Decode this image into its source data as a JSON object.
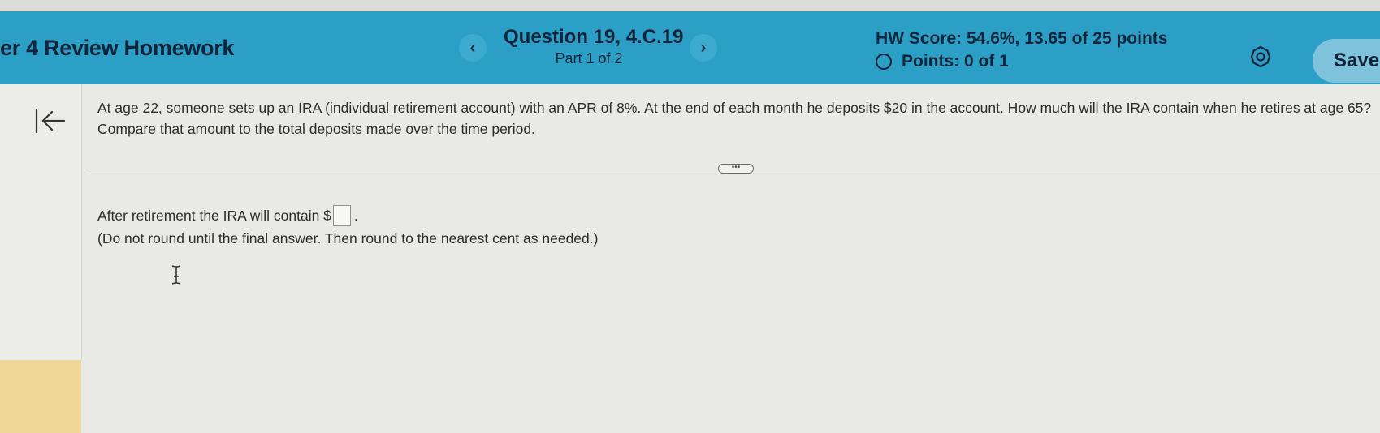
{
  "header": {
    "title": "er 4 Review Homework",
    "prev_icon": "chevron-left-icon",
    "next_icon": "chevron-right-icon",
    "prev_label": "‹",
    "next_label": "›",
    "question_title": "Question 19, 4.C.19",
    "question_part": "Part 1 of 2",
    "hw_score": "HW Score: 54.6%, 13.65 of 25 points",
    "points": "Points: 0 of 1",
    "save_label": "Save",
    "colors": {
      "bar": "#2b9fc6",
      "save": "#7fc2dc",
      "text": "#12243a"
    }
  },
  "question": {
    "text": "At age 22, someone sets up an IRA (individual retirement account) with an APR of 8%. At the end of each month he deposits $20 in the account. How much will the IRA contain when he retires at age 65? Compare that amount to the total deposits made over the time period.",
    "more_label": "•••"
  },
  "answer": {
    "prompt": "After retirement the IRA will contain $",
    "value": "",
    "suffix": ".",
    "hint": "(Do not round until the final answer. Then round to the nearest cent as needed.)"
  }
}
